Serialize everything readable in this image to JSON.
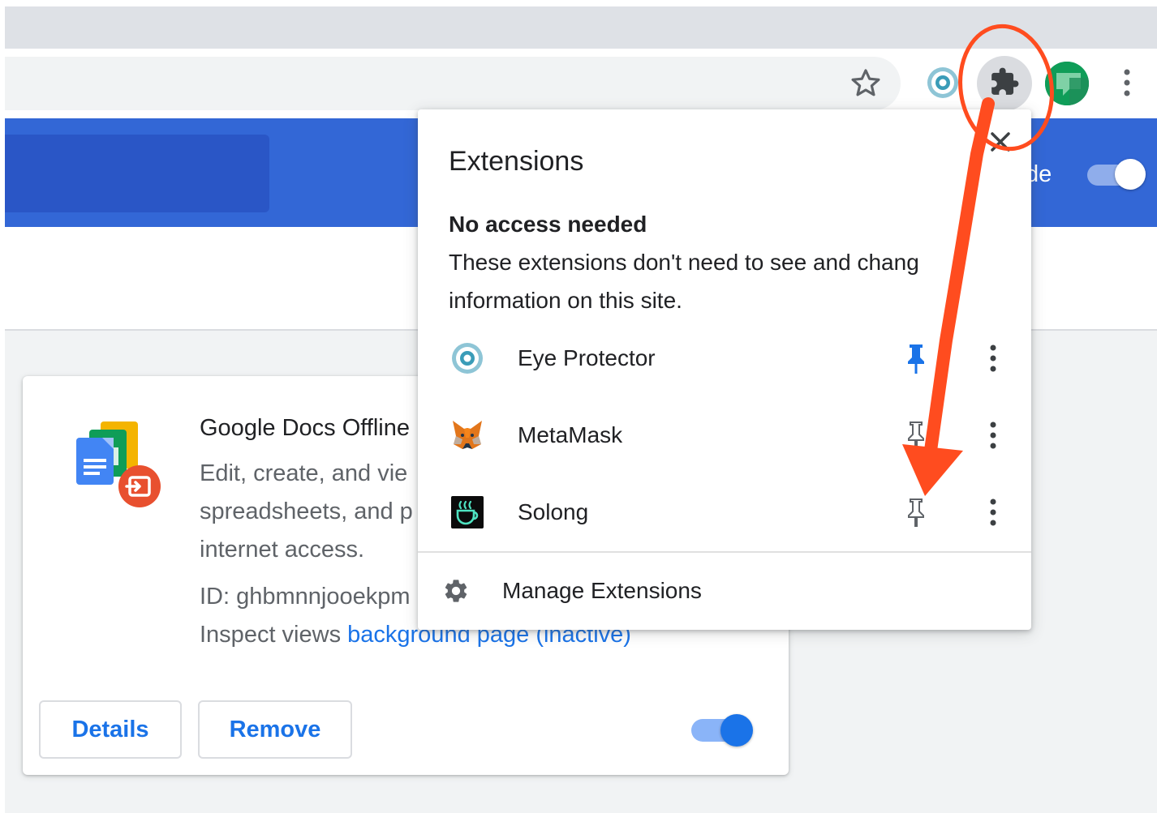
{
  "page_header": {
    "dev_mode_label_fragment": "de"
  },
  "extension_card": {
    "title": "Google Docs Offline",
    "description_lines": [
      "Edit, create, and vie",
      "spreadsheets, and p",
      "internet access."
    ],
    "id_label": "ID: ghbmnnjooekpm",
    "inspect_label": "Inspect views ",
    "inspect_link": "background page (inactive)",
    "details_label": "Details",
    "remove_label": "Remove"
  },
  "popup": {
    "title": "Extensions",
    "section_heading": "No access needed",
    "section_description_lines": [
      "These extensions don't need to see and chang",
      "information on this site."
    ],
    "extensions": [
      {
        "name": "Eye Protector",
        "pinned": true
      },
      {
        "name": "MetaMask",
        "pinned": false
      },
      {
        "name": "Solong",
        "pinned": false
      }
    ],
    "manage_label": "Manage Extensions"
  },
  "colors": {
    "header_blue": "#3367d6",
    "link_blue": "#1a73e8",
    "annotation_red": "#ff4c1f"
  },
  "icons": [
    "star-icon",
    "eye-protector-icon",
    "puzzle-icon",
    "avatar",
    "more-vertical-icon",
    "close-icon",
    "pin-icon",
    "metamask-fox-icon",
    "solong-icon",
    "gear-icon",
    "google-docs-offline-icon"
  ]
}
